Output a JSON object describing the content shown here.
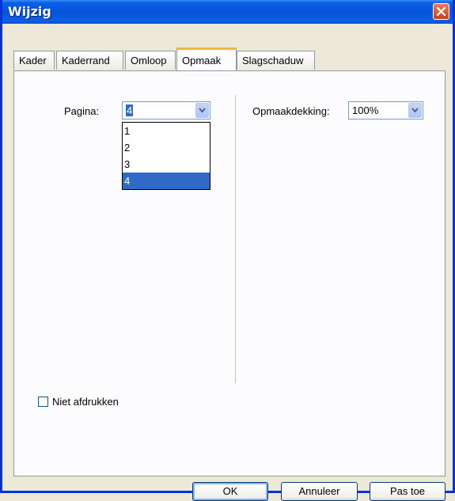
{
  "window": {
    "title": "Wijzig"
  },
  "tabs": [
    {
      "label": "Kader"
    },
    {
      "label": "Kaderrand"
    },
    {
      "label": "Omloop"
    },
    {
      "label": "Opmaak",
      "active": true
    },
    {
      "label": "Slagschaduw"
    }
  ],
  "page": {
    "label": "Pagina:",
    "value": "4",
    "options": [
      "1",
      "2",
      "3",
      "4"
    ],
    "selected": "4"
  },
  "opacity": {
    "label": "Opmaakdekking:",
    "value": "100%"
  },
  "checkbox": {
    "label": "Niet afdrukken",
    "checked": false
  },
  "buttons": {
    "ok": "OK",
    "cancel": "Annuleer",
    "apply": "Pas toe"
  },
  "colors": {
    "titlebar": "#0754d6",
    "selection": "#316ac5",
    "tab_highlight": "#f7b540"
  }
}
